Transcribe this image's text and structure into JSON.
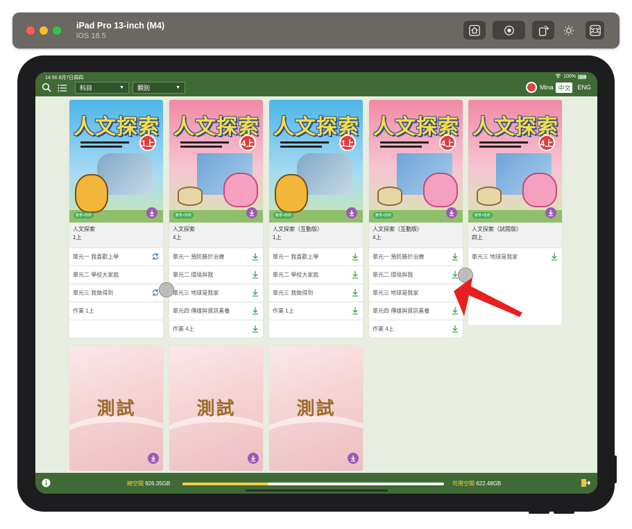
{
  "simulator": {
    "title": "iPad Pro 13-inch (M4)",
    "subtitle": "iOS 18.5",
    "buttons": [
      "home-icon",
      "screenshot-icon",
      "rotate-icon",
      "appearance-icon",
      "keyboard-shortcut-icon"
    ]
  },
  "status": {
    "time": "14:56  8月7日周四",
    "battery": "100%"
  },
  "toolbar": {
    "subject_select": "科目",
    "category_select": "類別",
    "user_name": "Mina",
    "lang_zh": "中文",
    "lang_en": "ENG"
  },
  "books": [
    {
      "cover_title": "人文探索",
      "cover_grade": "1上",
      "cover_tag": "教育+技術",
      "name": "人文探索",
      "grade": "1上",
      "items": [
        {
          "label": "單元一  我喜歡上學",
          "icon": "sync-icon"
        },
        {
          "label": "單元二  學校大家庭",
          "icon": ""
        },
        {
          "label": "單元三  我做得到",
          "icon": "sync-icon"
        },
        {
          "label": "作業  1上",
          "icon": ""
        }
      ]
    },
    {
      "cover_title": "人文探索",
      "cover_grade": "4上",
      "cover_tag": "教育+技術",
      "name": "人文探索",
      "grade": "4上",
      "items": [
        {
          "label": "單元一  預防勝於治療",
          "icon": "download-icon"
        },
        {
          "label": "單元二  環境與我",
          "icon": "download-icon"
        },
        {
          "label": "單元三  地球是我家",
          "icon": "download-icon"
        },
        {
          "label": "單元四  傳媒與資訊素養",
          "icon": "download-icon"
        },
        {
          "label": "作業  4上",
          "icon": "download-icon"
        }
      ]
    },
    {
      "cover_title": "人文探索",
      "cover_grade": "1上",
      "cover_tag": "教育+技術",
      "name": "人文探索（互動版）",
      "grade": "1上",
      "items": [
        {
          "label": "單元一  我喜歡上學",
          "icon": "download-icon"
        },
        {
          "label": "單元二  學校大家庭",
          "icon": "download-icon"
        },
        {
          "label": "單元三  我做得到",
          "icon": "download-icon"
        },
        {
          "label": "作業  1上",
          "icon": "download-icon"
        }
      ]
    },
    {
      "cover_title": "人文探索",
      "cover_grade": "4上",
      "cover_tag": "教育+技術",
      "name": "人文探索（互動版）",
      "grade": "4上",
      "items": [
        {
          "label": "單元一  預防勝於治療",
          "icon": "download-icon"
        },
        {
          "label": "單元二  環境與我",
          "icon": "download-icon"
        },
        {
          "label": "單元三  地球是我家",
          "icon": ""
        },
        {
          "label": "單元四  傳媒與資訊素養",
          "icon": "download-icon"
        },
        {
          "label": "作業  4上",
          "icon": "download-icon"
        }
      ]
    },
    {
      "cover_title": "人文探索",
      "cover_grade": "4上",
      "cover_tag": "教育+技術",
      "name": "人文探索（試閱版）",
      "grade": "四上",
      "items": [
        {
          "label": "單元三  地球是我家",
          "icon": "download-icon"
        }
      ]
    }
  ],
  "tests": [
    {
      "title": "測試"
    },
    {
      "title": "測試"
    },
    {
      "title": "測試"
    }
  ],
  "storage": {
    "total_label": "總空間",
    "total_value": "926.35GB",
    "free_label": "可用空間",
    "free_value": "622.48GB",
    "used_fraction": 0.328
  },
  "colors": {
    "bar_green": "#3f6a35",
    "background": "#e7eee0",
    "download_green": "#3aa64a",
    "sync_blue": "#2f6fd1",
    "badge_purple": "#9b59b6",
    "progress_yellow": "#f0d04a",
    "annotation_arrow": "#e81f1f"
  }
}
